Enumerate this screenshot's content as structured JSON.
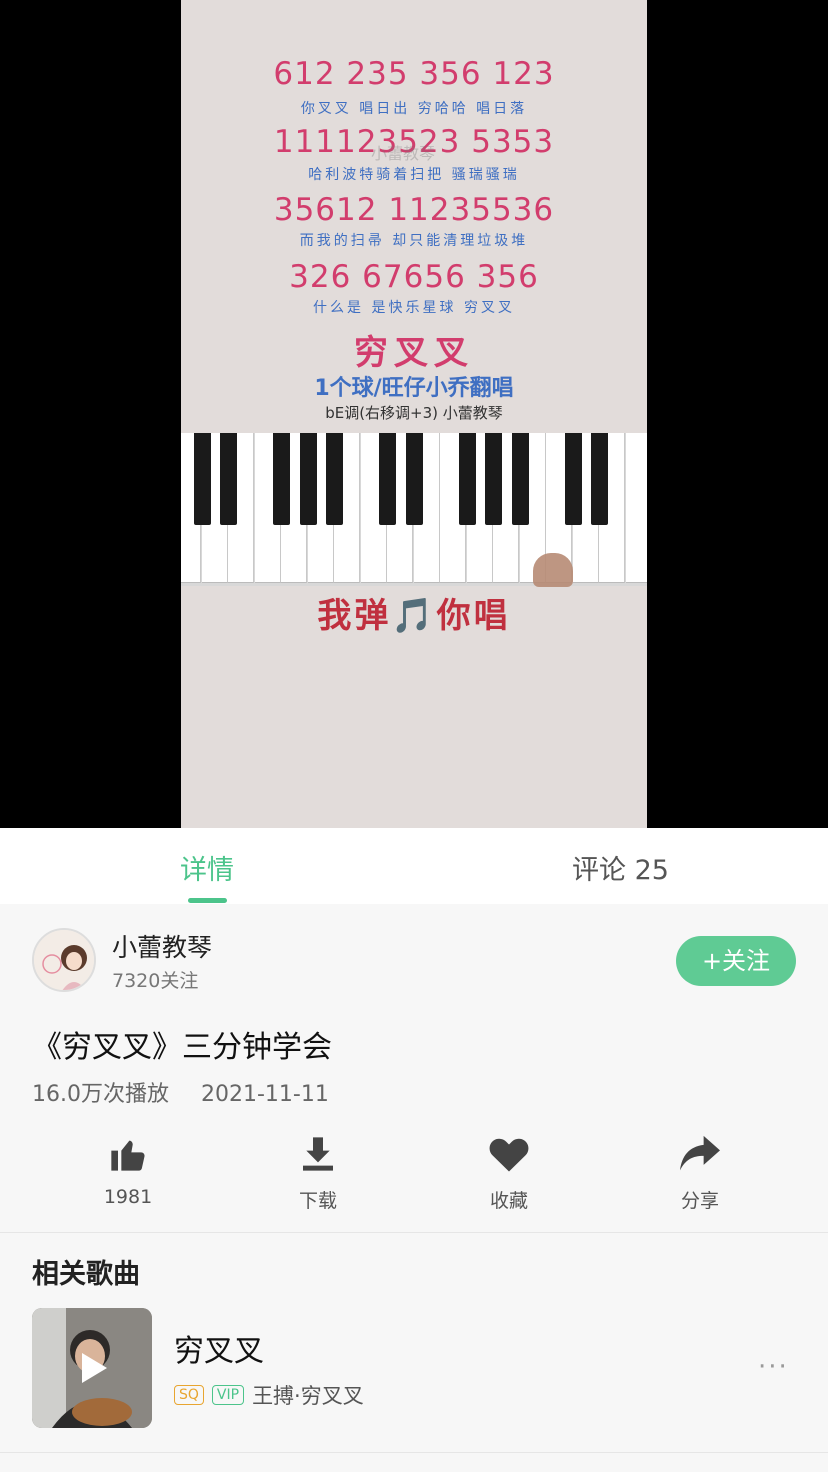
{
  "video": {
    "lines": [
      {
        "notes": "612 235 356 123",
        "lyrics": "你叉叉 唱日出 穷哈哈  唱日落"
      },
      {
        "notes": "111123523 5353",
        "lyrics": "哈利波特骑着扫把  骚瑞骚瑞"
      },
      {
        "notes": "35612 11235536",
        "lyrics": "而我的扫帚 却只能清理垃圾堆"
      },
      {
        "notes": "326 67656 356",
        "lyrics": "什么是 是快乐星球 穷叉叉"
      }
    ],
    "watermark": "小蕾教琴",
    "song_title": "穷叉叉",
    "singers": "1个球/旺仔小乔翻唱",
    "key_info": "bE调(右移调+3)  小蕾教琴",
    "tagline": "我弹🎵你唱"
  },
  "tabs": {
    "details": "详情",
    "comments": "评论 25"
  },
  "author": {
    "name": "小蕾教琴",
    "followers": "7320关注",
    "follow_label": "+关注"
  },
  "post": {
    "title": "《穷叉叉》三分钟学会",
    "plays": "16.0万次播放",
    "date": "2021-11-11"
  },
  "actions": {
    "like": {
      "label": "1981",
      "icon": "thumbs-up-icon"
    },
    "download": {
      "label": "下载",
      "icon": "download-icon"
    },
    "favorite": {
      "label": "收藏",
      "icon": "heart-icon"
    },
    "share": {
      "label": "分享",
      "icon": "share-icon"
    }
  },
  "related": {
    "heading": "相关歌曲",
    "items": [
      {
        "title": "穷叉叉",
        "badge_sq": "SQ",
        "badge_vip": "VIP",
        "artist": "王搏·穷叉叉",
        "more": "···"
      }
    ]
  },
  "colors": {
    "accent": "#4cc48b",
    "notes": "#d23d6d",
    "lyrics": "#3f6fc2"
  }
}
